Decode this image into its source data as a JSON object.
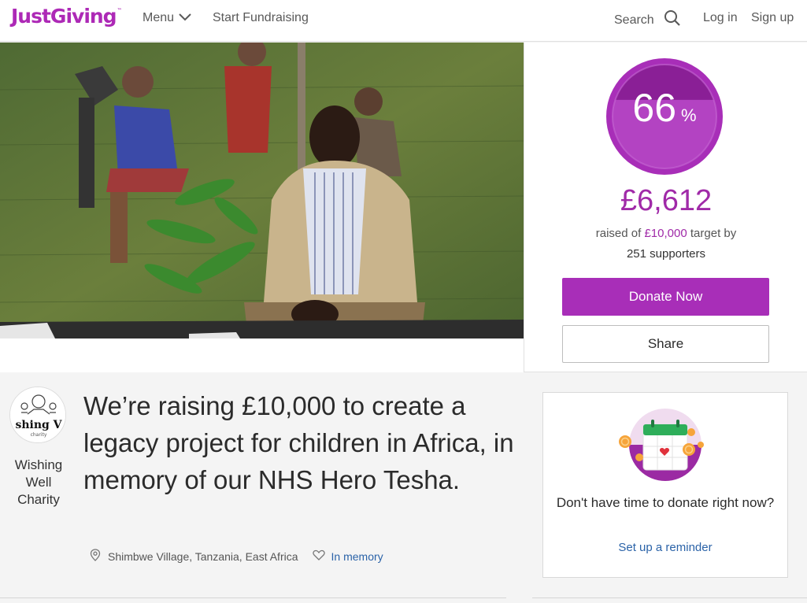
{
  "header": {
    "logo": "JustGiving",
    "logo_tm": "™",
    "menu_label": "Menu",
    "start_label": "Start Fundraising",
    "search_label": "Search",
    "login_label": "Log in",
    "signup_label": "Sign up"
  },
  "totaliser": {
    "percent": "66",
    "percent_sign": "%",
    "progress_fraction": 0.66,
    "amount": "£6,612",
    "raised_prefix": "raised of",
    "target": "£10,000",
    "raised_suffix": "target by",
    "supporters": "251 supporters",
    "donate_label": "Donate Now",
    "share_label": "Share"
  },
  "charity": {
    "logo_text": "shing V",
    "logo_subtext": "charity",
    "name": "Wishing Well Charity"
  },
  "page": {
    "headline": "We’re raising £10,000 to create a legacy project for children in Africa, in memory of our NHS Hero Tesha.",
    "location": "Shimbwe Village, Tanzania, East Africa",
    "category": "In memory"
  },
  "reminder": {
    "text": "Don't have time to donate right now?",
    "link": "Set up a reminder"
  },
  "colors": {
    "brand": "#ad29b6",
    "link": "#2b63a8"
  }
}
